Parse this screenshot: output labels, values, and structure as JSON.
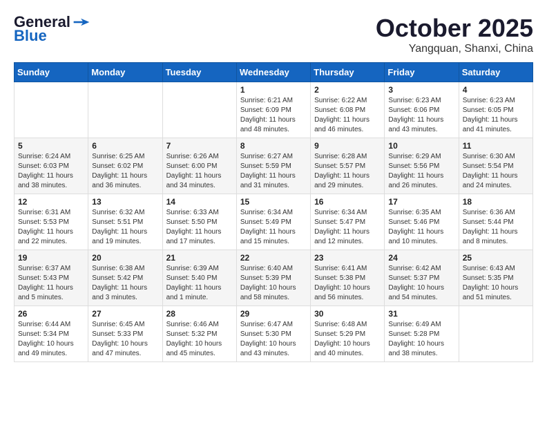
{
  "logo": {
    "line1": "General",
    "line2": "Blue"
  },
  "title": "October 2025",
  "location": "Yangquan, Shanxi, China",
  "weekdays": [
    "Sunday",
    "Monday",
    "Tuesday",
    "Wednesday",
    "Thursday",
    "Friday",
    "Saturday"
  ],
  "weeks": [
    [
      {
        "day": "",
        "info": ""
      },
      {
        "day": "",
        "info": ""
      },
      {
        "day": "",
        "info": ""
      },
      {
        "day": "1",
        "info": "Sunrise: 6:21 AM\nSunset: 6:09 PM\nDaylight: 11 hours\nand 48 minutes."
      },
      {
        "day": "2",
        "info": "Sunrise: 6:22 AM\nSunset: 6:08 PM\nDaylight: 11 hours\nand 46 minutes."
      },
      {
        "day": "3",
        "info": "Sunrise: 6:23 AM\nSunset: 6:06 PM\nDaylight: 11 hours\nand 43 minutes."
      },
      {
        "day": "4",
        "info": "Sunrise: 6:23 AM\nSunset: 6:05 PM\nDaylight: 11 hours\nand 41 minutes."
      }
    ],
    [
      {
        "day": "5",
        "info": "Sunrise: 6:24 AM\nSunset: 6:03 PM\nDaylight: 11 hours\nand 38 minutes."
      },
      {
        "day": "6",
        "info": "Sunrise: 6:25 AM\nSunset: 6:02 PM\nDaylight: 11 hours\nand 36 minutes."
      },
      {
        "day": "7",
        "info": "Sunrise: 6:26 AM\nSunset: 6:00 PM\nDaylight: 11 hours\nand 34 minutes."
      },
      {
        "day": "8",
        "info": "Sunrise: 6:27 AM\nSunset: 5:59 PM\nDaylight: 11 hours\nand 31 minutes."
      },
      {
        "day": "9",
        "info": "Sunrise: 6:28 AM\nSunset: 5:57 PM\nDaylight: 11 hours\nand 29 minutes."
      },
      {
        "day": "10",
        "info": "Sunrise: 6:29 AM\nSunset: 5:56 PM\nDaylight: 11 hours\nand 26 minutes."
      },
      {
        "day": "11",
        "info": "Sunrise: 6:30 AM\nSunset: 5:54 PM\nDaylight: 11 hours\nand 24 minutes."
      }
    ],
    [
      {
        "day": "12",
        "info": "Sunrise: 6:31 AM\nSunset: 5:53 PM\nDaylight: 11 hours\nand 22 minutes."
      },
      {
        "day": "13",
        "info": "Sunrise: 6:32 AM\nSunset: 5:51 PM\nDaylight: 11 hours\nand 19 minutes."
      },
      {
        "day": "14",
        "info": "Sunrise: 6:33 AM\nSunset: 5:50 PM\nDaylight: 11 hours\nand 17 minutes."
      },
      {
        "day": "15",
        "info": "Sunrise: 6:34 AM\nSunset: 5:49 PM\nDaylight: 11 hours\nand 15 minutes."
      },
      {
        "day": "16",
        "info": "Sunrise: 6:34 AM\nSunset: 5:47 PM\nDaylight: 11 hours\nand 12 minutes."
      },
      {
        "day": "17",
        "info": "Sunrise: 6:35 AM\nSunset: 5:46 PM\nDaylight: 11 hours\nand 10 minutes."
      },
      {
        "day": "18",
        "info": "Sunrise: 6:36 AM\nSunset: 5:44 PM\nDaylight: 11 hours\nand 8 minutes."
      }
    ],
    [
      {
        "day": "19",
        "info": "Sunrise: 6:37 AM\nSunset: 5:43 PM\nDaylight: 11 hours\nand 5 minutes."
      },
      {
        "day": "20",
        "info": "Sunrise: 6:38 AM\nSunset: 5:42 PM\nDaylight: 11 hours\nand 3 minutes."
      },
      {
        "day": "21",
        "info": "Sunrise: 6:39 AM\nSunset: 5:40 PM\nDaylight: 11 hours\nand 1 minute."
      },
      {
        "day": "22",
        "info": "Sunrise: 6:40 AM\nSunset: 5:39 PM\nDaylight: 10 hours\nand 58 minutes."
      },
      {
        "day": "23",
        "info": "Sunrise: 6:41 AM\nSunset: 5:38 PM\nDaylight: 10 hours\nand 56 minutes."
      },
      {
        "day": "24",
        "info": "Sunrise: 6:42 AM\nSunset: 5:37 PM\nDaylight: 10 hours\nand 54 minutes."
      },
      {
        "day": "25",
        "info": "Sunrise: 6:43 AM\nSunset: 5:35 PM\nDaylight: 10 hours\nand 51 minutes."
      }
    ],
    [
      {
        "day": "26",
        "info": "Sunrise: 6:44 AM\nSunset: 5:34 PM\nDaylight: 10 hours\nand 49 minutes."
      },
      {
        "day": "27",
        "info": "Sunrise: 6:45 AM\nSunset: 5:33 PM\nDaylight: 10 hours\nand 47 minutes."
      },
      {
        "day": "28",
        "info": "Sunrise: 6:46 AM\nSunset: 5:32 PM\nDaylight: 10 hours\nand 45 minutes."
      },
      {
        "day": "29",
        "info": "Sunrise: 6:47 AM\nSunset: 5:30 PM\nDaylight: 10 hours\nand 43 minutes."
      },
      {
        "day": "30",
        "info": "Sunrise: 6:48 AM\nSunset: 5:29 PM\nDaylight: 10 hours\nand 40 minutes."
      },
      {
        "day": "31",
        "info": "Sunrise: 6:49 AM\nSunset: 5:28 PM\nDaylight: 10 hours\nand 38 minutes."
      },
      {
        "day": "",
        "info": ""
      }
    ]
  ]
}
